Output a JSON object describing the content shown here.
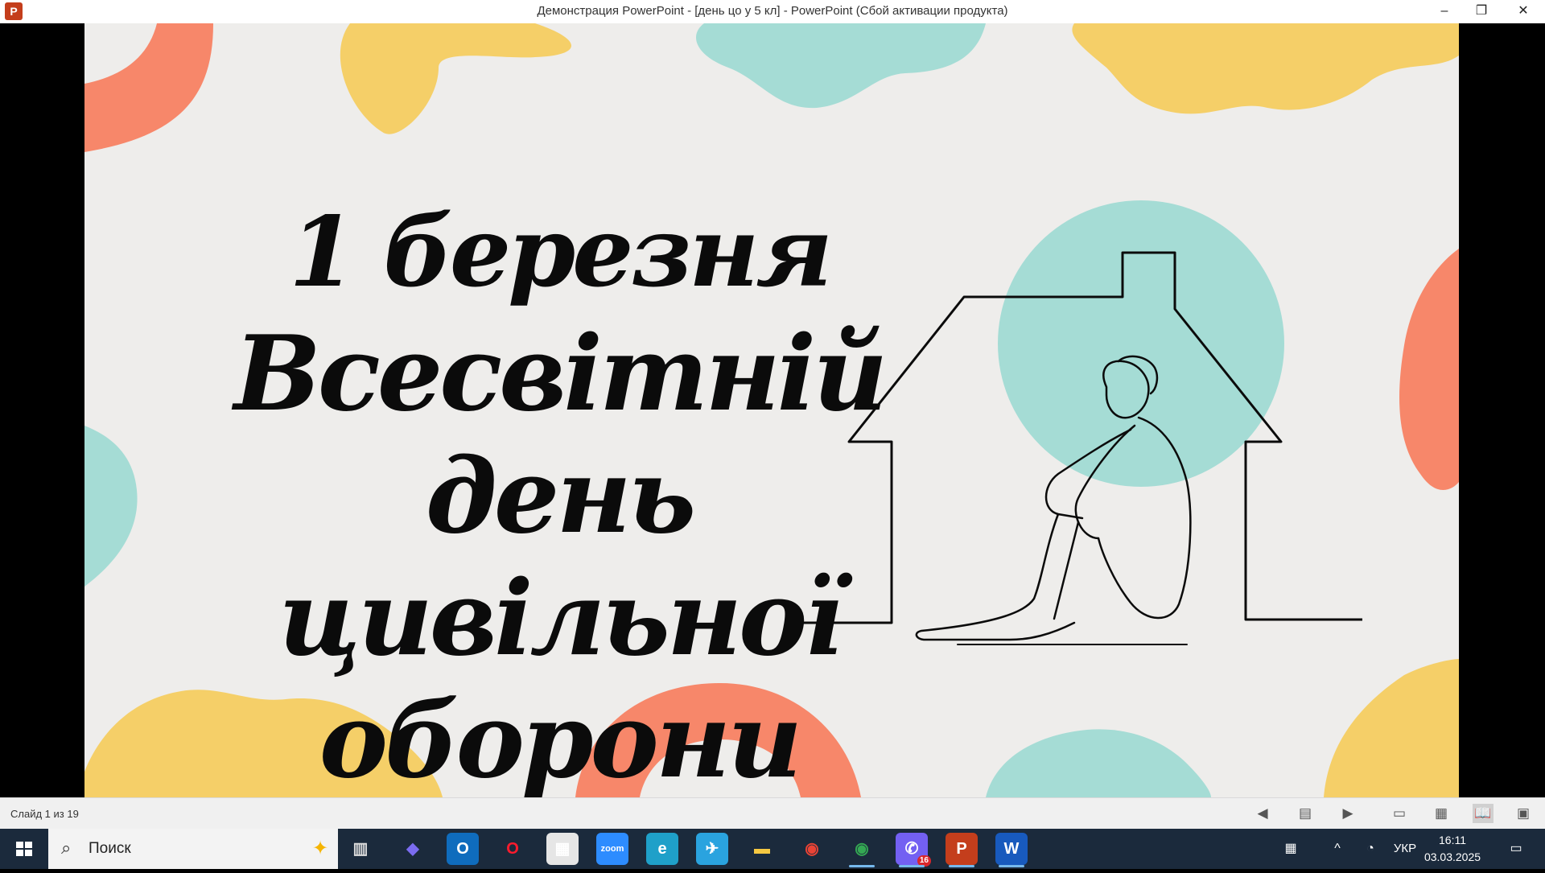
{
  "window": {
    "title": "Демонстрация PowerPoint - [день цо у 5 кл] - PowerPoint (Сбой активации продукта)",
    "app_icon": "powerpoint-icon",
    "app_icon_letter": "P",
    "controls": {
      "minimize": "–",
      "maximize": "❐",
      "close": "✕"
    }
  },
  "slide": {
    "line1": "1 березня",
    "line2": "Всесвітній день",
    "line3": "цивільної оборони",
    "colors": {
      "yellow": "#f5cf68",
      "coral": "#f7876a",
      "teal": "#a5dcd5",
      "paper": "#eeedeb"
    }
  },
  "status": {
    "slide_info": "Слайд 1 из 19",
    "buttons": {
      "prev": "◀",
      "notes": "▤",
      "next": "▶",
      "normal": "▭",
      "sorter": "▦",
      "reading": "📖",
      "slideshow": "▣"
    }
  },
  "taskbar": {
    "search_label": "Поиск",
    "apps": [
      {
        "name": "copilot-icon",
        "glyph": "◆",
        "color": "#7b6cf0",
        "bg": "transparent"
      },
      {
        "name": "outlook-icon",
        "glyph": "O",
        "color": "#ffffff",
        "bg": "#0f6cbd"
      },
      {
        "name": "opera-icon",
        "glyph": "O",
        "color": "#ff1b2d",
        "bg": "transparent"
      },
      {
        "name": "store-icon",
        "glyph": "▦",
        "color": "#ffffff",
        "bg": "#e6e6e6"
      },
      {
        "name": "zoom-icon",
        "glyph": "zoom",
        "color": "#ffffff",
        "bg": "#2d8cff"
      },
      {
        "name": "edge-icon",
        "glyph": "e",
        "color": "#ffffff",
        "bg": "#1fa0c9"
      },
      {
        "name": "telegram-icon",
        "glyph": "✈",
        "color": "#ffffff",
        "bg": "#2aa3df"
      },
      {
        "name": "explorer-icon",
        "glyph": "▬",
        "color": "#f5c842",
        "bg": "transparent"
      },
      {
        "name": "chrome-icon",
        "glyph": "◉",
        "color": "#ea4335",
        "bg": "transparent"
      },
      {
        "name": "chrome-profile-icon",
        "glyph": "◉",
        "color": "#34a853",
        "bg": "transparent"
      },
      {
        "name": "viber-icon",
        "glyph": "✆",
        "color": "#ffffff",
        "bg": "#7360f2",
        "badge": "16"
      },
      {
        "name": "powerpoint-taskbar-icon",
        "glyph": "P",
        "color": "#ffffff",
        "bg": "#c43e1c"
      },
      {
        "name": "word-icon",
        "glyph": "W",
        "color": "#ffffff",
        "bg": "#185abd"
      }
    ],
    "tray": {
      "keyboard_icon": "▦",
      "chevron": "^",
      "network": "◔",
      "language": "УКР",
      "notifications": "▭"
    },
    "time": "16:11",
    "date": "03.03.2025"
  }
}
